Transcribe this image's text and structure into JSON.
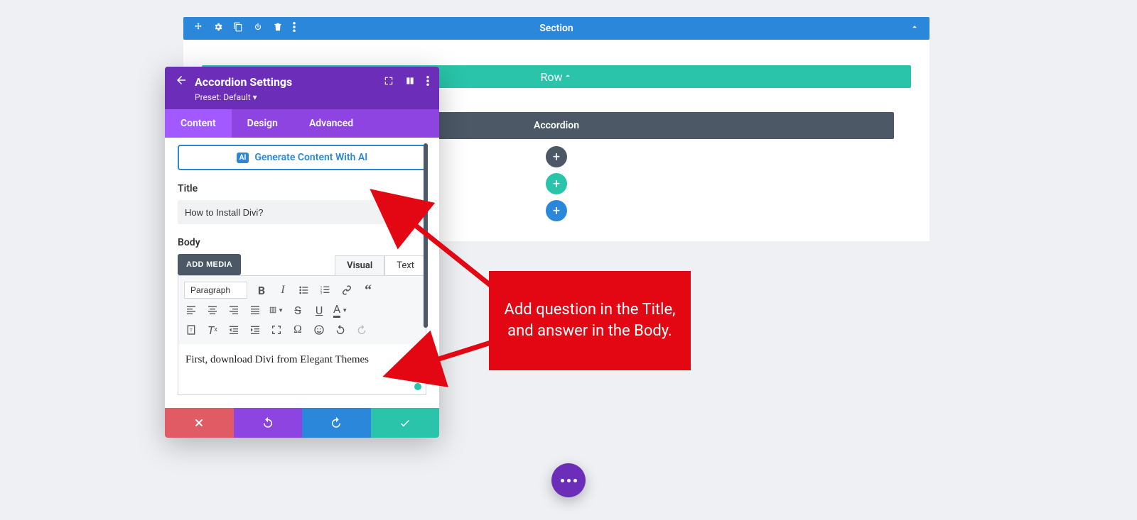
{
  "canvas": {
    "section_label": "Section",
    "row_label": "Row",
    "module_label": "Accordion"
  },
  "modal": {
    "title": "Accordion Settings",
    "preset_label": "Preset: Default",
    "tabs": {
      "content": "Content",
      "design": "Design",
      "advanced": "Advanced"
    },
    "ai_button": "Generate Content With AI",
    "ai_badge": "AI",
    "title_field_label": "Title",
    "title_value": "How to Install Divi?",
    "body_field_label": "Body",
    "add_media": "ADD MEDIA",
    "mode_visual": "Visual",
    "mode_text": "Text",
    "paragraph_label": "Paragraph",
    "body_content": "First, download Divi from Elegant Themes"
  },
  "annotation": {
    "text": "Add question in the Title, and answer in the Body."
  }
}
